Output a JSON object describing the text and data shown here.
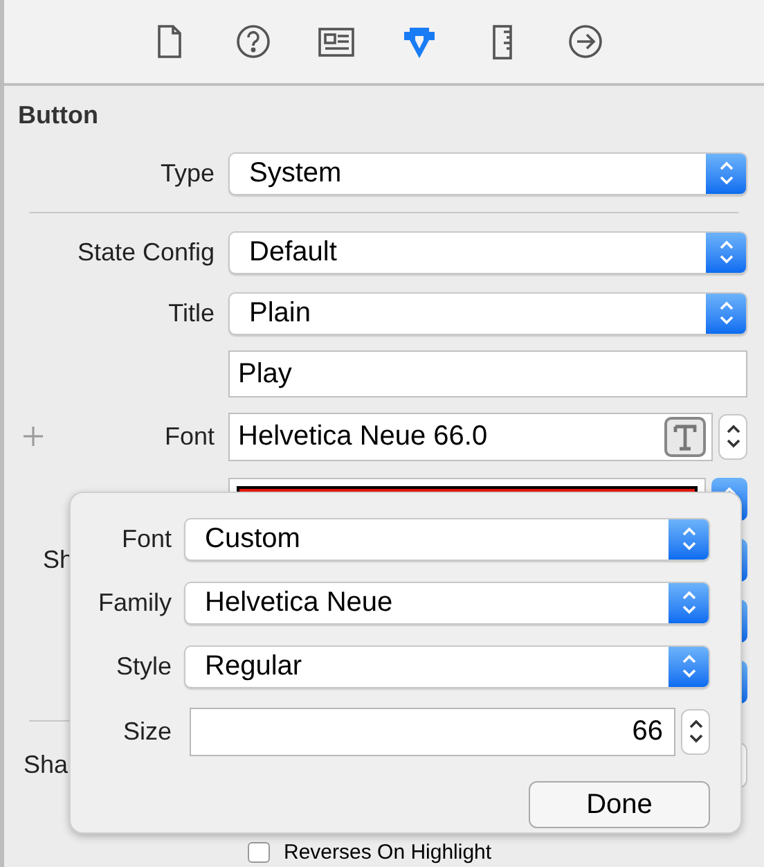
{
  "toolbar": {
    "tabs": [
      {
        "selected": false
      },
      {
        "selected": false
      },
      {
        "selected": false
      },
      {
        "selected": true
      },
      {
        "selected": false
      },
      {
        "selected": false
      }
    ]
  },
  "section_title": "Button",
  "rows": [
    {
      "kind": "popup",
      "label": "Type",
      "value": "System"
    },
    {
      "kind": "divider"
    },
    {
      "kind": "popup",
      "label": "State Config",
      "value": "Default"
    },
    {
      "kind": "popup",
      "label": "Title",
      "value": "Plain"
    },
    {
      "kind": "text",
      "value": "Play"
    },
    {
      "kind": "font",
      "label": "Font",
      "value": "Helvetica Neue 66.0"
    },
    {
      "kind": "color",
      "color": "#e8180c"
    },
    {
      "kind": "covered",
      "label": "Sh"
    },
    {
      "kind": "covered"
    },
    {
      "kind": "covered"
    },
    {
      "kind": "divider"
    },
    {
      "kind": "stepper",
      "label": "Sha"
    },
    {
      "kind": "checkbox",
      "label": "Reverses On Highlight",
      "checked": false
    }
  ],
  "font_popover": {
    "rows": [
      {
        "kind": "popup",
        "label": "Font",
        "value": "Custom"
      },
      {
        "kind": "popup",
        "label": "Family",
        "value": "Helvetica Neue"
      },
      {
        "kind": "popup",
        "label": "Style",
        "value": "Regular"
      },
      {
        "kind": "number",
        "label": "Size",
        "value": "66"
      }
    ],
    "button": "Done"
  }
}
